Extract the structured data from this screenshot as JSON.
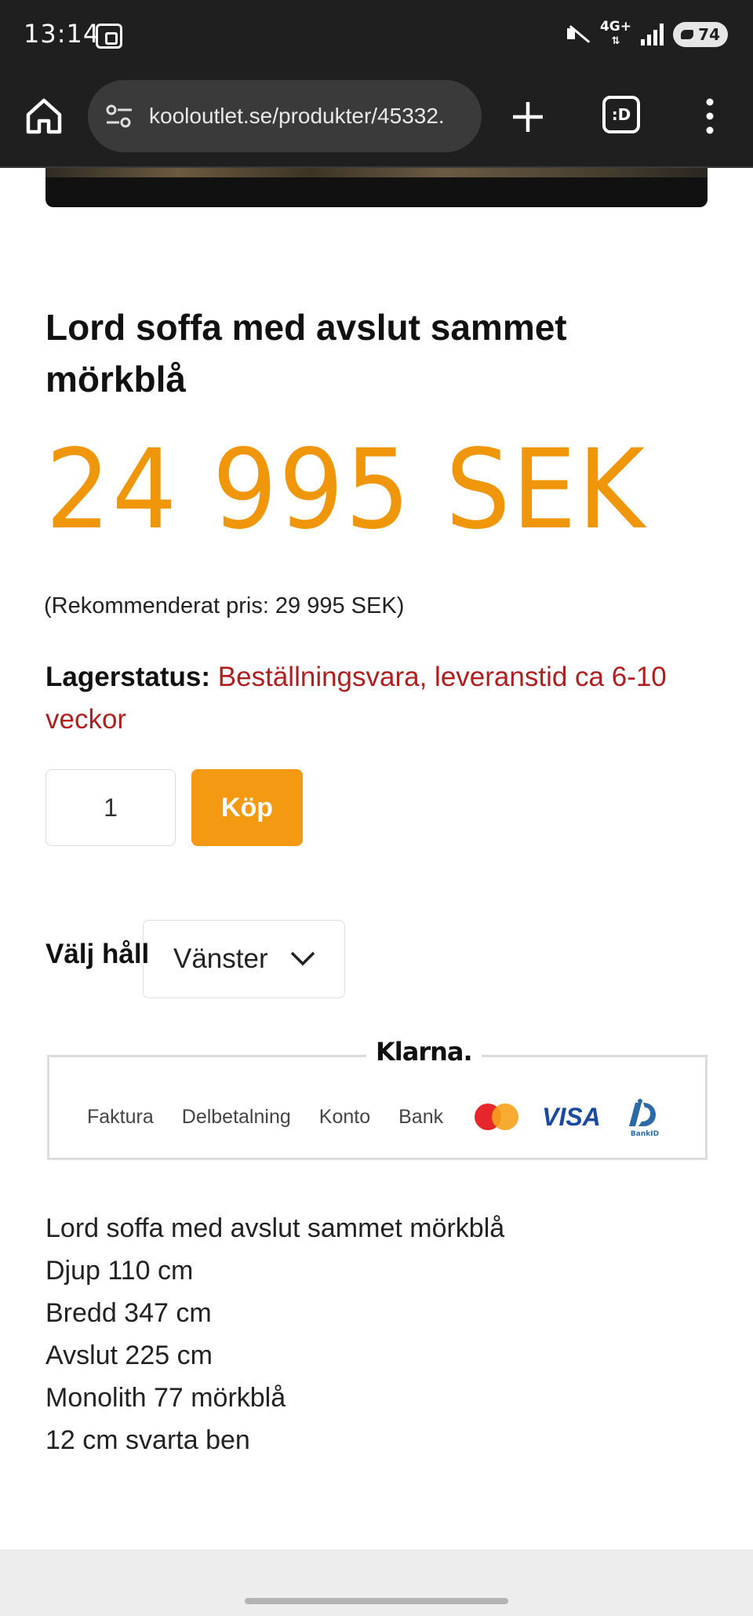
{
  "status_bar": {
    "time": "13:14",
    "network": "4G+",
    "battery": "74"
  },
  "browser": {
    "url": "kooloutlet.se/produkter/45332.",
    "tabs_label": ":D"
  },
  "product": {
    "title": "Lord soffa med avslut sammet mörkblå",
    "price": "24 995 SEK",
    "recommended_price": "(Rekommenderat pris: 29 995 SEK)",
    "stock_label": "Lagerstatus:",
    "stock_value": "Beställningsvara, leveranstid ca 6-10 veckor",
    "quantity": "1",
    "buy_label": "Köp",
    "hand_label": "Välj håll",
    "hand_selected": "Vänster"
  },
  "payment": {
    "brand": "Klarna.",
    "options": [
      "Faktura",
      "Delbetalning",
      "Konto",
      "Bank"
    ],
    "visa": "VISA",
    "bankid": "BankID",
    "mastercard_color_red": "#e7262b",
    "mastercard_color_yellow": "#f7a21b"
  },
  "description": [
    "Lord soffa med avslut sammet mörkblå",
    "Djup 110 cm",
    "Bredd 347 cm",
    "Avslut 225 cm",
    "Monolith 77 mörkblå",
    "12 cm svarta ben"
  ],
  "colors": {
    "price": "#f0960a",
    "stock": "#b01e1e",
    "buy_button": "#f39a12"
  }
}
